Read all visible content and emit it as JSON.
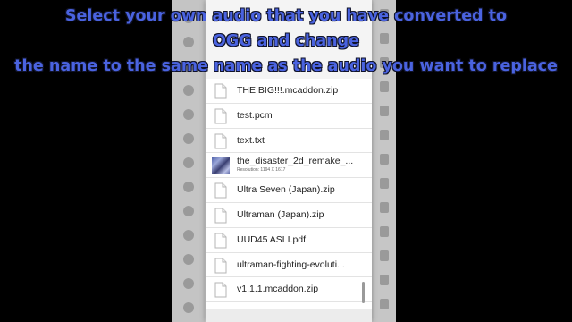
{
  "caption": {
    "line1": "Select your own audio that you have converted to",
    "line2": "OGG and change",
    "line3": "the name to the same name as the audio you want to replace"
  },
  "files": [
    {
      "name": "THE BIG!!!.mcaddon.zip",
      "icon": "file-icon"
    },
    {
      "name": "test.pcm",
      "icon": "file-icon"
    },
    {
      "name": "text.txt",
      "icon": "file-icon"
    },
    {
      "name": "the_disaster_2d_remake_...",
      "icon": "image-thumbnail",
      "meta": "Resolution: 1194 X 1617"
    },
    {
      "name": "Ultra Seven (Japan).zip",
      "icon": "file-icon"
    },
    {
      "name": "Ultraman (Japan).zip",
      "icon": "file-icon"
    },
    {
      "name": "UUD45 ASLI.pdf",
      "icon": "file-icon"
    },
    {
      "name": "ultraman-fighting-evoluti...",
      "icon": "file-icon"
    },
    {
      "name": "v1.1.1.mcaddon.zip",
      "icon": "file-icon"
    }
  ],
  "colors": {
    "caption_text": "#4a63e0",
    "dialog_bg": "#ffffff",
    "page_bg": "#000000"
  }
}
